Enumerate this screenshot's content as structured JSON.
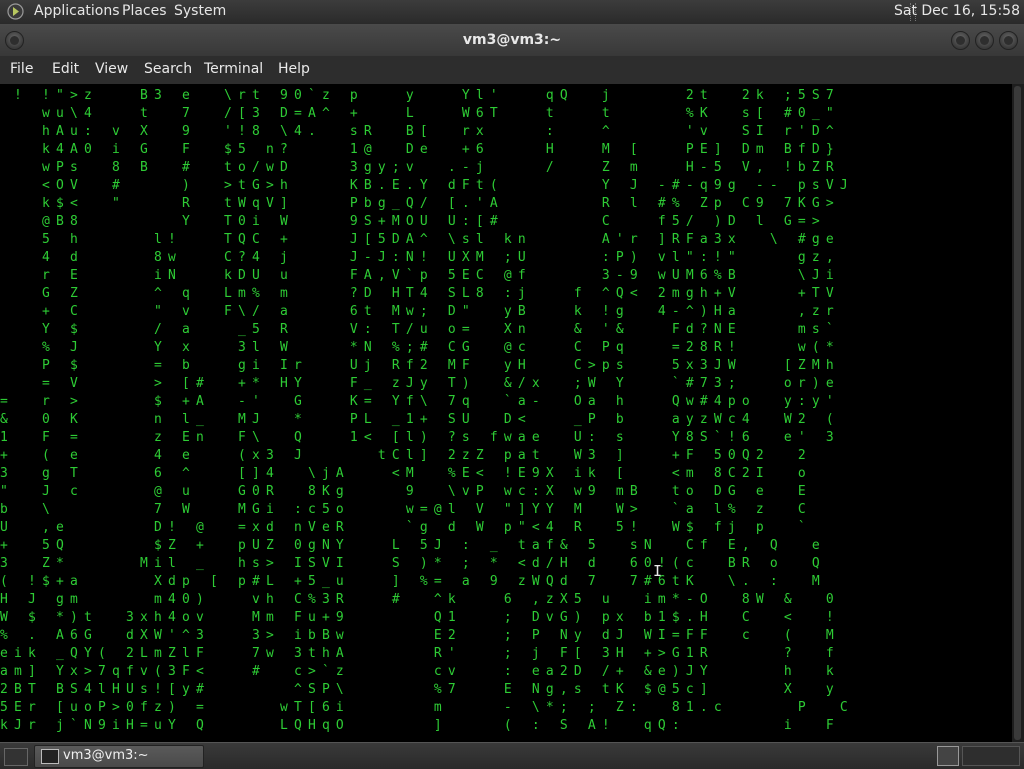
{
  "top_panel": {
    "menus": [
      "Applications",
      "Places",
      "System"
    ],
    "clock": "Sat Dec 16, 15:58"
  },
  "window": {
    "title": "vm3@vm3:~"
  },
  "menubar": [
    "File",
    "Edit",
    "View",
    "Search",
    "Terminal",
    "Help"
  ],
  "terminal": {
    "lines": [
      "  !   ! \" > z       B 3   e     \\ r t   9 0 ` z   p       y       Y l '       q Q     j           2 t     2 k   ; 5 S 7",
      "      w u \\ 4       t     7     / [ 3   D = A ^   +       L       W 6 T       t       t           % K     s [   # 0 _ \"",
      "      h A u :   v   X     9     ' ! 8   \\ 4 .     s R     B [     r x         :       ^           ' v     S I   r ' D ^",
      "      k 4 A 0   i   G     F     $ 5   n ?         1 @     D e     + 6         H       M   [       P E ]   D m   B f D }",
      "      w P s     8   B     #     t o / w D         3 g y ; v     . - j         /       Z   m       H - 5   V ,   ! b Z R",
      "      < O V     #         )     > t G > h         K B . E . Y   d F t (               Y   J   - # - q 9 g   - -   p s V J",
      "      k $ <     \"         R     t W q V ]         P b g _ Q /   [ . ' A               R   l   # %   Z p   C 9   7 K G >",
      "      @ B 8               Y     T 0 i   W         9 S + M O U   U : [ #               C       f 5 /   ) D   l   G = >",
      "      5   h           l !       T Q C   +         J [ 5 D A ^   \\ s l   k n           A ' r   ] R F a 3 x     \\   # g e",
      "      4   d           8 w       C ? 4   j         J - J : N !   U X M   ; U           : P )   v l \" : ! \"         g z ,",
      "      r   E           i N       k D U   u         F A , V ` p   5 E C   @ f           3 - 9   w U M 6 % B         \\ J i",
      "      G   Z           ^   q     L m %   m         ? D   H T 4   S L 8   : j       f   ^ Q <   2 m g h + V         + T V",
      "      +   C           \"   v     F \\ /   a         6 t   M w ;   D \"     y B       k   ! g     4 - ^ ) H a         , z r",
      "      Y   $           /   a       _ 5   R         V :   T / u   o =     X n       &   ' &       F d ? N E         m s `",
      "      %   J           Y   x       3 l   W         * N   % ; #   C G     @ c       C   P q       = 2 8 R !         w ( *",
      "      P   $           =   b       g i   I r       U j   R f 2   M F     y H       C > p s       5 x 3 J W       [ Z M h",
      "      =   V           >   [ #     + *   H Y       F _   z J y   T )     & / x     ; W   Y       ` # 7 3 ;       o r ) e",
      "=     r   >           $   + A     - '     G       K =   Y f \\   7 q     ` a -     O a   h       Q w # 4 p o     y : y '",
      "&     0   K           n   l _     M J     *       P L   _ 1 +   S U     D <       _ P   b       a y z W c 4     W 2   (",
      "1     F   =           z   E n     F \\     Q       1 <   [ l )   ? s   f w a e     U :   s       Y 8 S ` ! 6     e '   3",
      "+     (   e           4   e       ( x 3   J           t C l ]   2 z Z   p a t     W 3   ]       + F   5 0 Q 2     2",
      "3     g   T           6   ^       [ ] 4     \\ j A       < M     % E <   ! E 9 X   i k   [       < m   8 C 2 I     o",
      "\"     J   c           @   u       G 0 R     8 K g         9     \\ v P   w c : X   w 9   m B     t o   D G   e     E",
      "b     \\               7   W       M G i   : c 5 o         w = @ l   V   \" ] Y Y   M     W >     ` a   l %   z     C",
      "U     , e             D !   @     = x d   n V e R         ` g   d   W   p \" < 4   R     5 !     W $   f j   p     `",
      "+     5 Q             $ Z   +     p U Z   0 g N Y       L   5 J   :   _   t a f &   5     s N     C f   E ,   Q     e",
      "3     Z *           M i l   _     h s >   I S V I       S   ) *   ;   *   < d / H   d     6 0 ! ( c     B R   o     Q",
      "(   ! $ + a           X d p   [   p # L   + 5 _ u       ]   % =   a   9   z W Q d   7     7 # 6 t K     \\ .   :     M",
      "H   J   g m           m 4 0 )       v h   C % 3 R       #     ^ k       6   , z X 5   u     i m * - O     8 W   &     0",
      "W   $   * ) t     3 x h 4 o v       M m   F u + 9             Q 1       ;   D v G )   p x   b 1 $ . H     C     <     !",
      "%   .   A 6 G     d X W ' ^ 3       3 >   i b B w             E 2       ;   P   N y   d J   W I = F F     c     (     M",
      "e i k   _ Q Y (   2 L m Z l F       7 w   3 t h A             R '       ;   j   F [   3 H   + > G 1 R           ?     f",
      "a m ]   Y x > 7 q f v ( 3 F <       #     c > ` z             c v       :   e a 2 D   / +   & e ) J Y           h     k",
      "2 B T   B S 4 l H U s ! [ y #             ^ S P \\             % 7       E   N g , s   t K   $ @ 5 c ]           X     y",
      "5 E r   [ u o P > 0 f z )   =           w T [ 6 i             m         -   \\ * ;   ;   Z :     8 1 . c           P     C",
      "k J r   j ` N 9 i H = u Y   Q           L Q H q O             ]         (   :   S   A !     q Q :               i     F"
    ]
  },
  "taskbar": {
    "task_label": "vm3@vm3:~"
  }
}
